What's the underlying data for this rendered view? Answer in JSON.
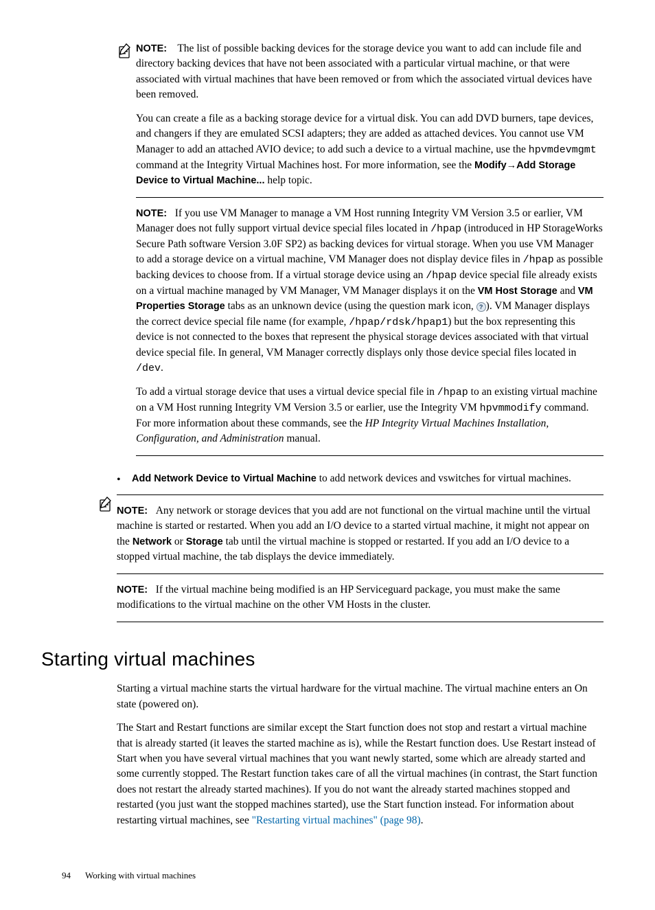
{
  "note1": {
    "label": "NOTE:",
    "p1a": "The list of possible backing devices for the storage device you want to add can include file and directory backing devices that have not been associated with a particular virtual machine, or that were associated with virtual machines that have been removed or from which the associated virtual devices have been removed.",
    "p2a": "You can create a file as a backing storage device for a virtual disk. You can add DVD burners, tape devices, and changers if they are emulated SCSI adapters; they are added as attached devices. You cannot use VM Manager to add an attached AVIO device; to add such a device to a virtual machine, use the ",
    "p2_code": "hpvmdevmgmt",
    "p2b": " command at the Integrity Virtual Machines host. For more information, see the ",
    "p2_bold": "Modify→Add Storage Device to Virtual Machine...",
    "p2c": " help topic."
  },
  "note2": {
    "label": "NOTE:",
    "p1a": "If you use VM Manager to manage a VM Host running Integrity VM Version 3.5 or earlier, VM Manager does not fully support virtual device special files located in ",
    "p1_c1": "/hpap",
    "p1b": " (introduced in HP StorageWorks Secure Path software Version 3.0F SP2) as backing devices for virtual storage. When you use VM Manager to add a storage device on a virtual machine, VM Manager does not display device files in ",
    "p1_c2": "/hpap",
    "p1c": " as possible backing devices to choose from. If a virtual storage device using an ",
    "p1_c3": "/hpap",
    "p1d": " device special file already exists on a virtual machine managed by VM Manager, VM Manager displays it on the ",
    "p1_b1": "VM Host Storage",
    "p1e": " and ",
    "p1_b2": "VM Properties Storage",
    "p1f": " tabs as an unknown device (using the question mark icon, ",
    "p1g": "). VM Manager displays the correct device special file name (for example, ",
    "p1_c4": "/hpap/rdsk/hpap1",
    "p1h": ") but the box representing this device is not connected to the boxes that represent the physical storage devices associated with that virtual device special file. In general, VM Manager correctly displays only those device special files located in ",
    "p1_c5": "/dev",
    "p1i": ".",
    "p2a": "To add a virtual storage device that uses a virtual device special file in ",
    "p2_c1": "/hpap",
    "p2b": " to an existing virtual machine on a VM Host running Integrity VM Version 3.5 or earlier, use the Integrity VM ",
    "p2_c2": "hpvmmodify",
    "p2c": " command. For more information about these commands, see the ",
    "p2_it": "HP Integrity Virtual Machines Installation, Configuration, and Administration",
    "p2d": " manual."
  },
  "bullet": {
    "bold": "Add Network Device to Virtual Machine",
    "rest": "  to add network devices and vswitches for virtual machines."
  },
  "note3": {
    "label": "NOTE:",
    "p1a": "Any network or storage devices that you add are not functional on the virtual machine until the virtual machine is started or restarted. When you add an I/O device to a started virtual machine, it might not appear on the ",
    "p1_b1": "Network",
    "p1b": " or ",
    "p1_b2": "Storage",
    "p1c": " tab until the virtual machine is stopped or restarted. If you add an I/O device to a stopped virtual machine, the tab displays the device immediately."
  },
  "note4": {
    "label": "NOTE:",
    "text": "If the virtual machine being modified is an HP Serviceguard package, you must make the same modifications to the virtual machine on the other VM Hosts in the cluster."
  },
  "section": {
    "heading": "Starting virtual machines",
    "p1": "Starting a virtual machine starts the virtual hardware for the virtual machine. The virtual machine enters an On state (powered on).",
    "p2a": "The Start and Restart functions are similar except the Start function does not stop and restart a virtual machine that is already started (it leaves the started machine as is), while the Restart function does. Use Restart instead of Start when you have several virtual machines that you want newly started, some which are already started and some currently stopped. The Restart function takes care of all the virtual machines (in contrast, the Start function does not restart the already started machines). If you do not want the already started machines stopped and restarted (you just want the stopped machines started), use the Start function instead. For information about restarting virtual machines, see ",
    "p2_link": "\"Restarting virtual machines\" (page 98)",
    "p2b": "."
  },
  "footer": {
    "page": "94",
    "chapter": "Working with virtual machines"
  }
}
